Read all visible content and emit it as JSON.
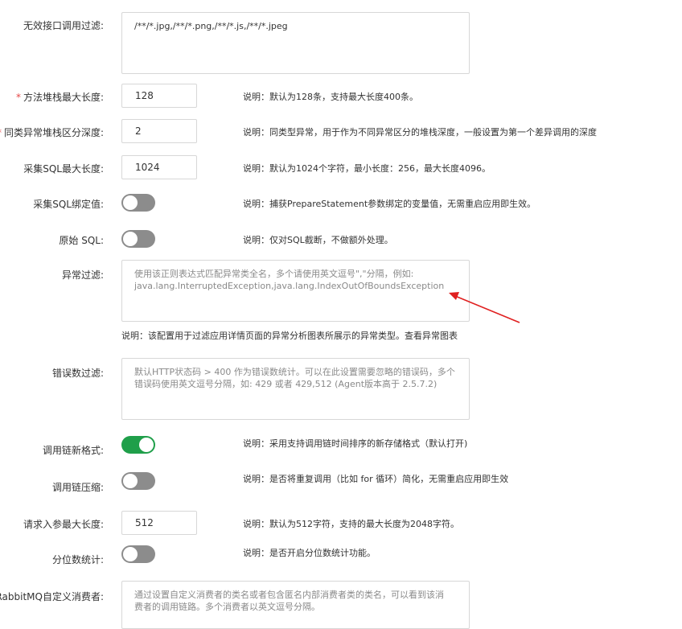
{
  "rows": {
    "invalid_filter": {
      "label": "无效接口调用过滤:",
      "value": "/**/*.jpg,/**/*.png,/**/*.js,/**/*.jpeg"
    },
    "stack_max_len": {
      "required": "*",
      "label": "方法堆栈最大长度:",
      "value": "128",
      "desc": "说明：默认为128条，支持最大长度400条。"
    },
    "same_exc_depth": {
      "required": "*",
      "label": "同类异常堆栈区分深度:",
      "value": "2",
      "desc": "说明：同类型异常，用于作为不同异常区分的堆栈深度，一般设置为第一个差异调用的深度"
    },
    "sql_max_len": {
      "label": "采集SQL最大长度:",
      "value": "1024",
      "desc": "说明：默认为1024个字符，最小长度：256，最大长度4096。"
    },
    "sql_bind": {
      "label": "采集SQL绑定值:",
      "desc": "说明：捕获PrepareStatement参数绑定的变量值，无需重启应用即生效。",
      "enabled": false
    },
    "raw_sql": {
      "label": "原始 SQL:",
      "desc": "说明：仅对SQL截断，不做额外处理。",
      "enabled": false
    },
    "exc_filter": {
      "label": "异常过滤:",
      "placeholder_line1": "使用该正则表达式匹配异常类全名，多个请使用英文逗号\",\"分隔，例如:",
      "placeholder_line2": "java.lang.InterruptedException,java.lang.IndexOutOfBoundsException",
      "desc": "说明：该配置用于过滤应用详情页面的异常分析图表所展示的异常类型。查看异常图表"
    },
    "err_count_filter": {
      "label": "错误数过滤:",
      "placeholder_line1": "默认HTTP状态码 > 400 作为错误数统计。可以在此设置需要忽略的错误码，多个",
      "placeholder_line2": "错误码使用英文逗号分隔，如: 429 或者 429,512 (Agent版本高于 2.5.7.2)"
    },
    "trace_new_format": {
      "label": "调用链新格式:",
      "desc": "说明：采用支持调用链时间排序的新存储格式（默认打开)",
      "enabled": true
    },
    "trace_compress": {
      "label": "调用链压缩:",
      "desc": "说明：是否将重复调用（比如 for 循环）简化，无需重启应用即生效",
      "enabled": false
    },
    "req_param_len": {
      "label": "请求入参最大长度:",
      "value": "512",
      "desc": "说明：默认为512字符，支持的最大长度为2048字符。"
    },
    "percentile": {
      "label": "分位数统计:",
      "desc": "说明：是否开启分位数统计功能。",
      "enabled": false
    },
    "rabbitmq": {
      "label": "RabbitMQ自定义消费者:",
      "placeholder_line1": "通过设置自定义消费者的类名或者包含匿名内部消费者类的类名，可以看到该消",
      "placeholder_line2": "费者的调用链路。多个消费者以英文逗号分隔。"
    }
  },
  "colors": {
    "toggle_on": "#1f9f4a",
    "toggle_off": "#8c8c8c",
    "required": "#e54545",
    "annotation_arrow": "#e02020"
  },
  "icons": {
    "annotation": "red-arrow-icon"
  }
}
